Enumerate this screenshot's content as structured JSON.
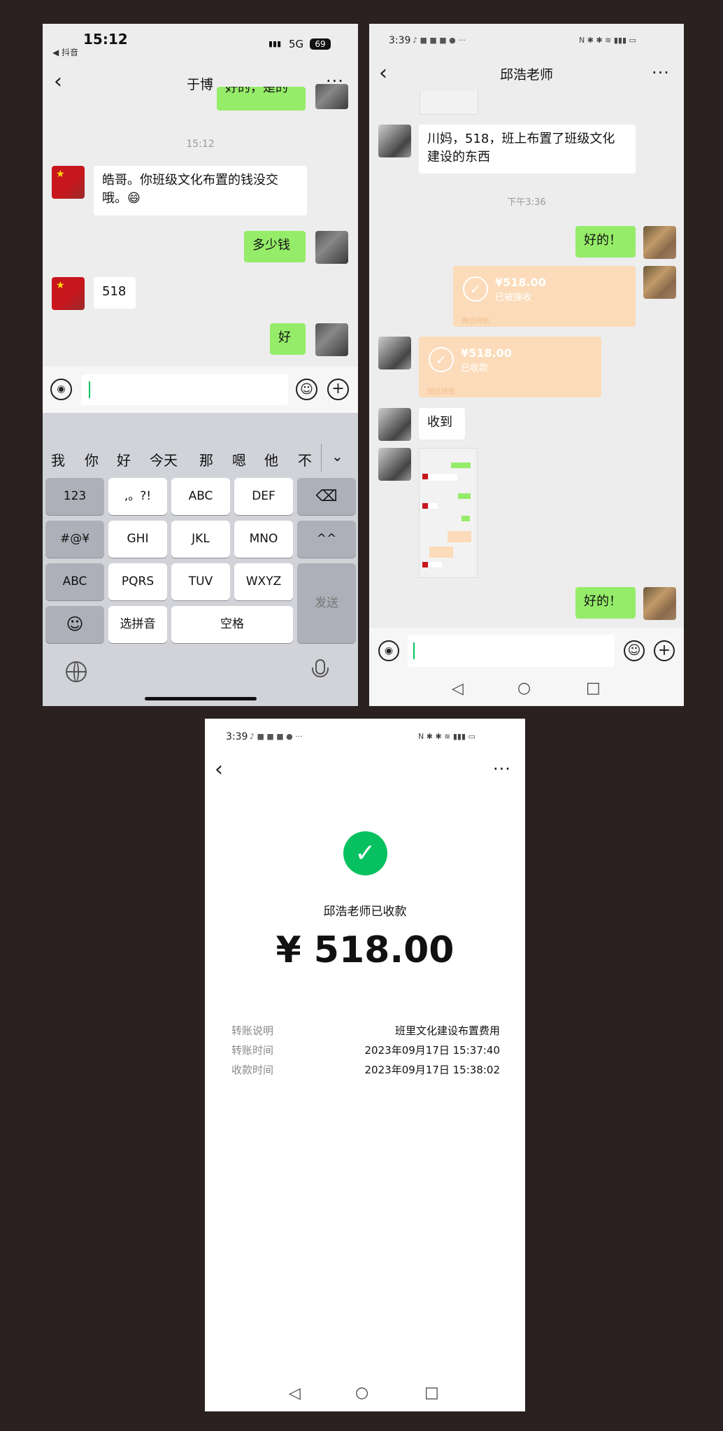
{
  "screen1": {
    "status_time": "15:12",
    "status_app": "◀ 抖音",
    "status_network": "5G",
    "status_battery": "69",
    "title": "于博",
    "top_partial_bubble": "好的，是的",
    "timestamp": "15:12",
    "messages": [
      {
        "side": "left",
        "text": "皓哥。你班级文化布置的钱没交哦。😄"
      },
      {
        "side": "right",
        "text": "多少钱"
      },
      {
        "side": "left",
        "text": "518"
      },
      {
        "side": "right",
        "text": "好"
      }
    ],
    "candidates": [
      "我",
      "你",
      "好",
      "今天",
      "那",
      "嗯",
      "他",
      "不"
    ],
    "keys": {
      "num": "123",
      "punct": ",。?!",
      "abc": "ABC",
      "def": "DEF",
      "delete": "⌫",
      "symbols": "#@¥",
      "ghi": "GHI",
      "jkl": "JKL",
      "mno": "MNO",
      "face": "^^",
      "abc_switch": "ABC",
      "pqrs": "PQRS",
      "tuv": "TUV",
      "wxyz": "WXYZ",
      "send": "发送",
      "emoji": "☺",
      "pinyin": "选拼音",
      "space": "空格"
    }
  },
  "screen2": {
    "status_time": "3:39",
    "title": "邱浩老师",
    "msg1": "川妈，518，班上布置了班级文化建设的东西",
    "timestamp": "下午3:36",
    "reply1": "好的！",
    "transfer1": {
      "amount": "¥518.00",
      "status": "已被接收",
      "footer": "微信转账"
    },
    "transfer2": {
      "amount": "¥518.00",
      "status": "已收款",
      "footer": "微信转账"
    },
    "msg2": "收到",
    "reply2": "好的！"
  },
  "screen3": {
    "status_time": "3:39",
    "payee_status": "邱浩老师已收款",
    "amount": "¥ 518.00",
    "rows": [
      {
        "label": "转账说明",
        "value": "班里文化建设布置费用"
      },
      {
        "label": "转账时间",
        "value": "2023年09月17日 15:37:40"
      },
      {
        "label": "收款时间",
        "value": "2023年09月17日 15:38:02"
      }
    ]
  }
}
